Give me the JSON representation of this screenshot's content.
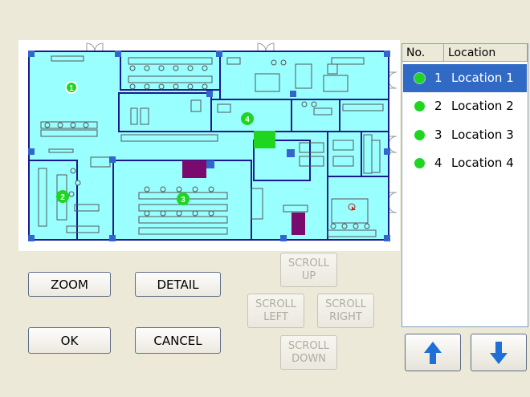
{
  "buttons": {
    "zoom": "ZOOM",
    "detail": "DETAIL",
    "ok": "OK",
    "cancel": "CANCEL"
  },
  "scroll": {
    "up": "SCROLL\nUP",
    "left": "SCROLL\nLEFT",
    "right": "SCROLL\nRIGHT",
    "down": "SCROLL\nDOWN"
  },
  "list": {
    "col_no": "No.",
    "col_location": "Location",
    "selected_index": 0,
    "rows": [
      {
        "no": "1",
        "name": "Location 1"
      },
      {
        "no": "2",
        "name": "Location 2"
      },
      {
        "no": "3",
        "name": "Location 3"
      },
      {
        "no": "4",
        "name": "Location 4"
      }
    ]
  },
  "plan": {
    "markers": [
      "1",
      "2",
      "3",
      "4"
    ]
  },
  "colors": {
    "floor": "#99ffff",
    "walls": "#1a1a8f",
    "marker": "#1fd51f",
    "selection": "#316ac5",
    "arrow": "#1e6fd6",
    "column": "#3366cc",
    "green_block": "#1fd51f",
    "purple_block": "#7a0a6e"
  },
  "icons": {
    "up": "up-arrow-icon",
    "down": "down-arrow-icon",
    "location": "location-dot-icon"
  }
}
